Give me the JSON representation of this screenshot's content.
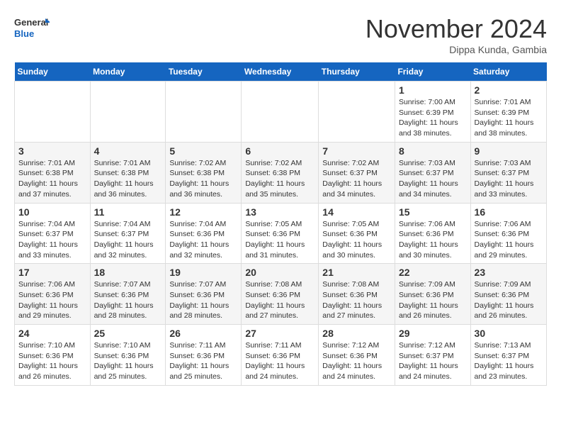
{
  "header": {
    "logo_line1": "General",
    "logo_line2": "Blue",
    "month": "November 2024",
    "location": "Dippa Kunda, Gambia"
  },
  "weekdays": [
    "Sunday",
    "Monday",
    "Tuesday",
    "Wednesday",
    "Thursday",
    "Friday",
    "Saturday"
  ],
  "weeks": [
    [
      {
        "day": "",
        "info": ""
      },
      {
        "day": "",
        "info": ""
      },
      {
        "day": "",
        "info": ""
      },
      {
        "day": "",
        "info": ""
      },
      {
        "day": "",
        "info": ""
      },
      {
        "day": "1",
        "info": "Sunrise: 7:00 AM\nSunset: 6:39 PM\nDaylight: 11 hours\nand 38 minutes."
      },
      {
        "day": "2",
        "info": "Sunrise: 7:01 AM\nSunset: 6:39 PM\nDaylight: 11 hours\nand 38 minutes."
      }
    ],
    [
      {
        "day": "3",
        "info": "Sunrise: 7:01 AM\nSunset: 6:38 PM\nDaylight: 11 hours\nand 37 minutes."
      },
      {
        "day": "4",
        "info": "Sunrise: 7:01 AM\nSunset: 6:38 PM\nDaylight: 11 hours\nand 36 minutes."
      },
      {
        "day": "5",
        "info": "Sunrise: 7:02 AM\nSunset: 6:38 PM\nDaylight: 11 hours\nand 36 minutes."
      },
      {
        "day": "6",
        "info": "Sunrise: 7:02 AM\nSunset: 6:38 PM\nDaylight: 11 hours\nand 35 minutes."
      },
      {
        "day": "7",
        "info": "Sunrise: 7:02 AM\nSunset: 6:37 PM\nDaylight: 11 hours\nand 34 minutes."
      },
      {
        "day": "8",
        "info": "Sunrise: 7:03 AM\nSunset: 6:37 PM\nDaylight: 11 hours\nand 34 minutes."
      },
      {
        "day": "9",
        "info": "Sunrise: 7:03 AM\nSunset: 6:37 PM\nDaylight: 11 hours\nand 33 minutes."
      }
    ],
    [
      {
        "day": "10",
        "info": "Sunrise: 7:04 AM\nSunset: 6:37 PM\nDaylight: 11 hours\nand 33 minutes."
      },
      {
        "day": "11",
        "info": "Sunrise: 7:04 AM\nSunset: 6:37 PM\nDaylight: 11 hours\nand 32 minutes."
      },
      {
        "day": "12",
        "info": "Sunrise: 7:04 AM\nSunset: 6:36 PM\nDaylight: 11 hours\nand 32 minutes."
      },
      {
        "day": "13",
        "info": "Sunrise: 7:05 AM\nSunset: 6:36 PM\nDaylight: 11 hours\nand 31 minutes."
      },
      {
        "day": "14",
        "info": "Sunrise: 7:05 AM\nSunset: 6:36 PM\nDaylight: 11 hours\nand 30 minutes."
      },
      {
        "day": "15",
        "info": "Sunrise: 7:06 AM\nSunset: 6:36 PM\nDaylight: 11 hours\nand 30 minutes."
      },
      {
        "day": "16",
        "info": "Sunrise: 7:06 AM\nSunset: 6:36 PM\nDaylight: 11 hours\nand 29 minutes."
      }
    ],
    [
      {
        "day": "17",
        "info": "Sunrise: 7:06 AM\nSunset: 6:36 PM\nDaylight: 11 hours\nand 29 minutes."
      },
      {
        "day": "18",
        "info": "Sunrise: 7:07 AM\nSunset: 6:36 PM\nDaylight: 11 hours\nand 28 minutes."
      },
      {
        "day": "19",
        "info": "Sunrise: 7:07 AM\nSunset: 6:36 PM\nDaylight: 11 hours\nand 28 minutes."
      },
      {
        "day": "20",
        "info": "Sunrise: 7:08 AM\nSunset: 6:36 PM\nDaylight: 11 hours\nand 27 minutes."
      },
      {
        "day": "21",
        "info": "Sunrise: 7:08 AM\nSunset: 6:36 PM\nDaylight: 11 hours\nand 27 minutes."
      },
      {
        "day": "22",
        "info": "Sunrise: 7:09 AM\nSunset: 6:36 PM\nDaylight: 11 hours\nand 26 minutes."
      },
      {
        "day": "23",
        "info": "Sunrise: 7:09 AM\nSunset: 6:36 PM\nDaylight: 11 hours\nand 26 minutes."
      }
    ],
    [
      {
        "day": "24",
        "info": "Sunrise: 7:10 AM\nSunset: 6:36 PM\nDaylight: 11 hours\nand 26 minutes."
      },
      {
        "day": "25",
        "info": "Sunrise: 7:10 AM\nSunset: 6:36 PM\nDaylight: 11 hours\nand 25 minutes."
      },
      {
        "day": "26",
        "info": "Sunrise: 7:11 AM\nSunset: 6:36 PM\nDaylight: 11 hours\nand 25 minutes."
      },
      {
        "day": "27",
        "info": "Sunrise: 7:11 AM\nSunset: 6:36 PM\nDaylight: 11 hours\nand 24 minutes."
      },
      {
        "day": "28",
        "info": "Sunrise: 7:12 AM\nSunset: 6:36 PM\nDaylight: 11 hours\nand 24 minutes."
      },
      {
        "day": "29",
        "info": "Sunrise: 7:12 AM\nSunset: 6:37 PM\nDaylight: 11 hours\nand 24 minutes."
      },
      {
        "day": "30",
        "info": "Sunrise: 7:13 AM\nSunset: 6:37 PM\nDaylight: 11 hours\nand 23 minutes."
      }
    ]
  ]
}
